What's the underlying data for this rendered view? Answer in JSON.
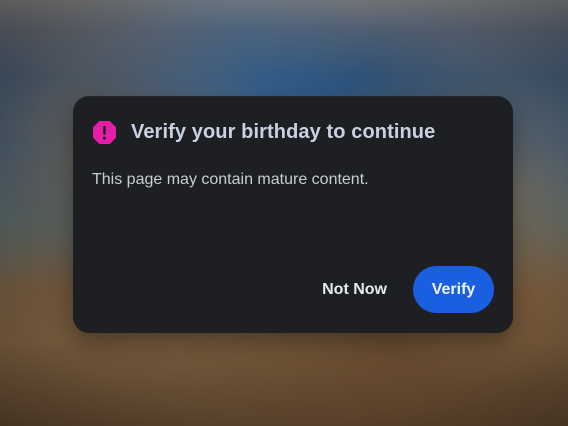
{
  "dialog": {
    "title": "Verify your birthday to continue",
    "message": "This page may contain mature content.",
    "buttons": {
      "secondary": "Not Now",
      "primary": "Verify"
    }
  },
  "icons": {
    "warning": "warning-octagon-icon"
  },
  "colors": {
    "dialog_background": "#1d1f22",
    "title_text": "#c9d2e3",
    "message_text": "#c8ccd3",
    "warning_icon": "#e61ea7",
    "primary_button": "#1a5fe0",
    "primary_button_text": "#eef4ff",
    "secondary_button_text": "#e6eaf2"
  }
}
